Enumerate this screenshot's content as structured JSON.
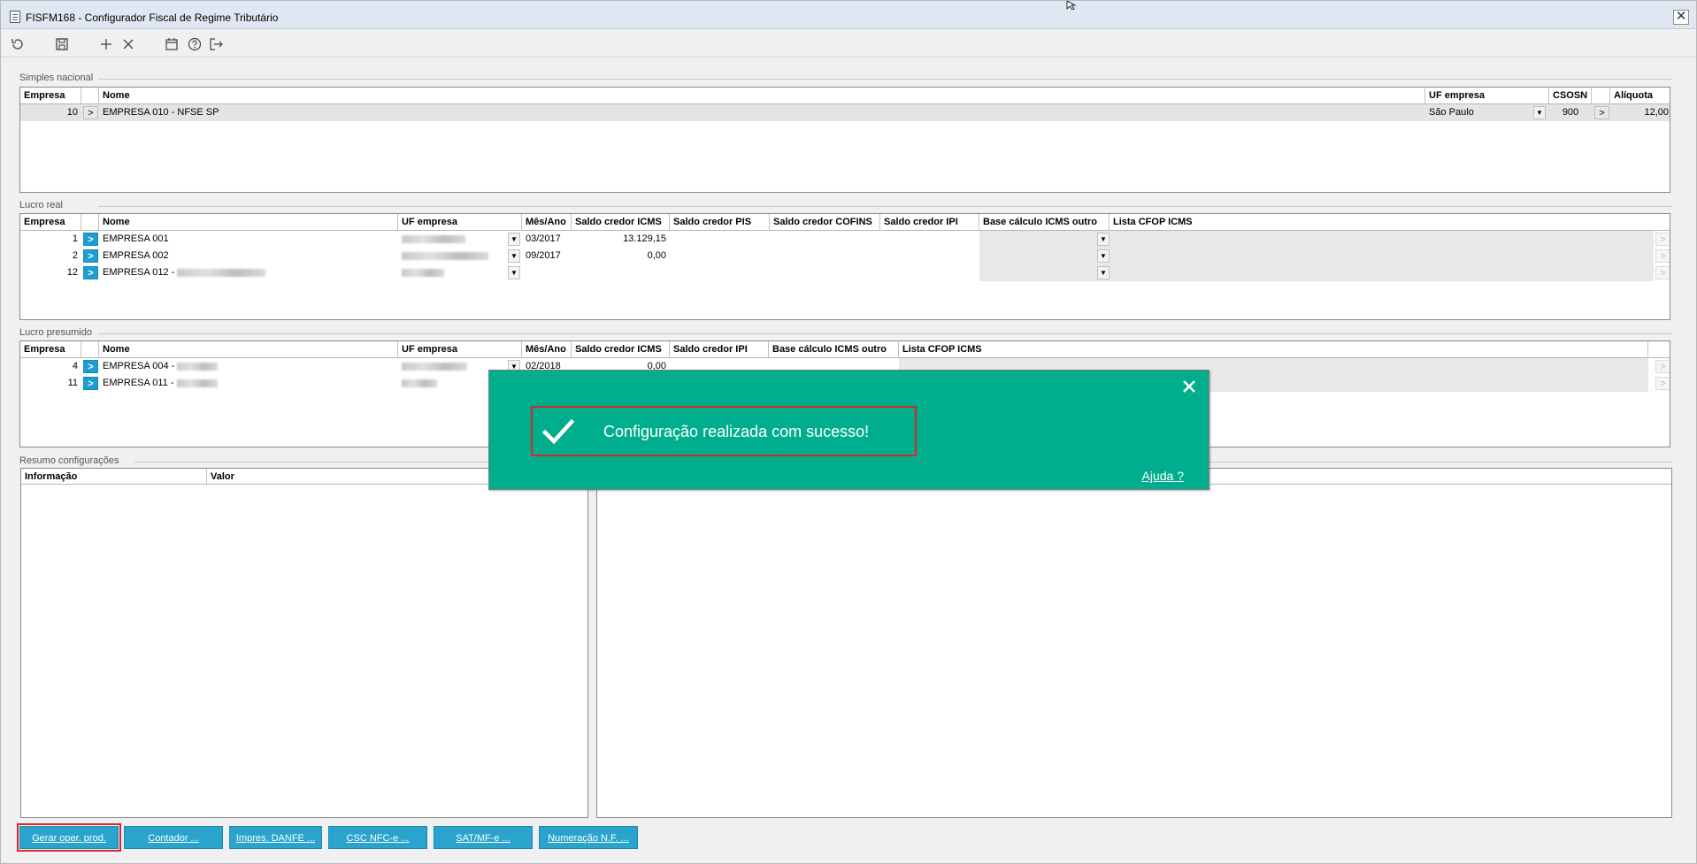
{
  "window": {
    "title": "FISFM168 - Configurador Fiscal de Regime Tributário",
    "close_label": "✕"
  },
  "toolbar": {
    "icons": [
      "refresh-icon",
      "save-icon",
      "add-icon",
      "delete-icon",
      "calendar-icon",
      "help-icon",
      "exit-icon"
    ]
  },
  "simples": {
    "title": "Simples nacional",
    "headers": [
      "Empresa",
      "",
      "Nome",
      "UF empresa",
      "CSOSN",
      "",
      "Alíquota"
    ],
    "rows": [
      {
        "empresa": "10",
        "nome": "EMPRESA 010 - NFSE SP",
        "uf": "São Paulo",
        "csosn": "900",
        "aliquota": "12,00"
      }
    ]
  },
  "lucro_real": {
    "title": "Lucro real",
    "headers": [
      "Empresa",
      "",
      "Nome",
      "UF empresa",
      "Mês/Ano",
      "Saldo credor ICMS",
      "Saldo credor PIS",
      "Saldo credor COFINS",
      "Saldo credor IPI",
      "Base cálculo ICMS outro",
      "Lista CFOP ICMS"
    ],
    "rows": [
      {
        "empresa": "1",
        "nome": "EMPRESA 001",
        "mes_ano": "03/2017",
        "saldo_icms": "13.129,15"
      },
      {
        "empresa": "2",
        "nome": "EMPRESA 002",
        "mes_ano": "09/2017",
        "saldo_icms": "0,00"
      },
      {
        "empresa": "12",
        "nome": "EMPRESA 012 -",
        "mes_ano": "",
        "saldo_icms": ""
      }
    ]
  },
  "lucro_presumido": {
    "title": "Lucro presumido",
    "headers": [
      "Empresa",
      "",
      "Nome",
      "UF empresa",
      "Mês/Ano",
      "Saldo credor ICMS",
      "Saldo credor IPI",
      "Base cálculo ICMS outro",
      "Lista CFOP ICMS"
    ],
    "rows": [
      {
        "empresa": "4",
        "nome": "EMPRESA 004 -",
        "mes_ano": "02/2018",
        "saldo_icms": "0,00"
      },
      {
        "empresa": "11",
        "nome": "EMPRESA 011 -",
        "mes_ano": "",
        "saldo_icms": ""
      }
    ]
  },
  "resumo": {
    "title": "Resumo configurações",
    "headers": [
      "Informação",
      "Valor"
    ]
  },
  "footer": {
    "buttons": [
      "Gerar oper. prod.",
      "Contador ...",
      "Impres. DANFE ...",
      "CSC NFC-e ...",
      "SAT/MF-e ...",
      "Numeração N.F. ..."
    ]
  },
  "toast": {
    "message": "Configuração realizada com sucesso!",
    "help_link": "Ajuda ?",
    "color": "#00ae8d"
  },
  "colors": {
    "accent_button": "#2aa4cc",
    "highlight": "#d8262b",
    "arrow_button": "#1e9ed0"
  }
}
